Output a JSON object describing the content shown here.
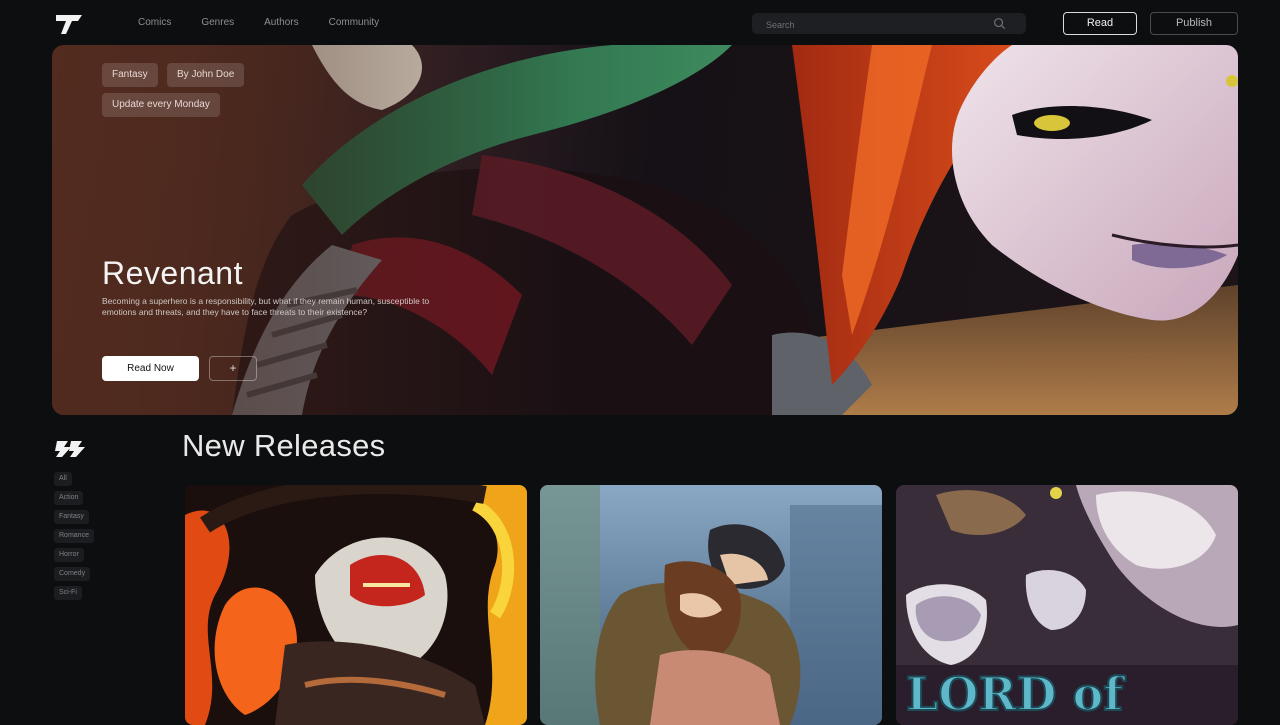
{
  "header": {
    "nav": [
      "Comics",
      "Genres",
      "Authors",
      "Community"
    ],
    "search": {
      "placeholder": "Search"
    },
    "read_label": "Read",
    "publish_label": "Publish"
  },
  "hero": {
    "tags": [
      "Fantasy",
      "By John Doe",
      "Update every Monday"
    ],
    "title": "Revenant",
    "description": "Becoming a superhero is a responsibility, but what if they remain human, susceptible to emotions and threats, and they have to face threats to their existence?",
    "read_now_label": "Read Now",
    "add_label": "+"
  },
  "sidebar": {
    "filters": [
      "All",
      "Action",
      "Fantasy",
      "Romance",
      "Horror",
      "Comedy",
      "Sci-Fi"
    ]
  },
  "new_releases": {
    "title": "New Releases",
    "cards": [
      {
        "name": "card-demon-fire",
        "caption": ""
      },
      {
        "name": "card-rain-embrace",
        "caption": ""
      },
      {
        "name": "card-lord-of",
        "caption": "LORD of"
      }
    ]
  },
  "colors": {
    "background": "#0d0e10",
    "accent": "#ffffff",
    "surface": "#1e1f22"
  }
}
